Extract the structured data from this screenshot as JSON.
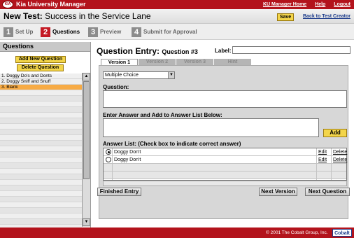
{
  "header": {
    "logo_text": "KIA",
    "app_title": "Kia University Manager",
    "links": [
      "KU Manager Home",
      "Help",
      "Logout"
    ]
  },
  "titlebar": {
    "prefix": "New Test:",
    "test_name": "Success in the Service Lane",
    "save_label": "Save",
    "back_label": "Back to Test Creator"
  },
  "steps": [
    {
      "num": "1",
      "label": "Set Up"
    },
    {
      "num": "2",
      "label": "Questions"
    },
    {
      "num": "3",
      "label": "Preview"
    },
    {
      "num": "4",
      "label": "Submit for Approval"
    }
  ],
  "left": {
    "header": "Questions",
    "add_label": "Add New Question",
    "delete_label": "Delete Question",
    "questions": [
      "1. Doggy Do's and Donts",
      "2. Doggy Sniff and Snuff",
      "3. Blank"
    ]
  },
  "main": {
    "title": "Question Entry:",
    "question_num": "Question #3",
    "label_label": "Label:",
    "tabs": [
      "Version 1",
      "Version 2",
      "Version 3",
      "Hint"
    ],
    "question_type": "Multiple Choice",
    "question_label": "Question:",
    "answer_label": "Enter Answer and Add to Answer List Below:",
    "add_label": "Add",
    "answer_list_label": "Answer List: (Check box to indicate correct answer)",
    "answers": [
      {
        "text": "Doggy Don't",
        "selected": true
      },
      {
        "text": "Doggy Don't",
        "selected": false
      }
    ],
    "edit_label": "Edit",
    "delete_label": "Delete",
    "finished_label": "Finished Entry",
    "next_version_label": "Next Version",
    "next_question_label": "Next Question"
  },
  "footer": {
    "copyright": "© 2001 The Cobalt Group, Inc.",
    "brand": "Cobalt"
  }
}
